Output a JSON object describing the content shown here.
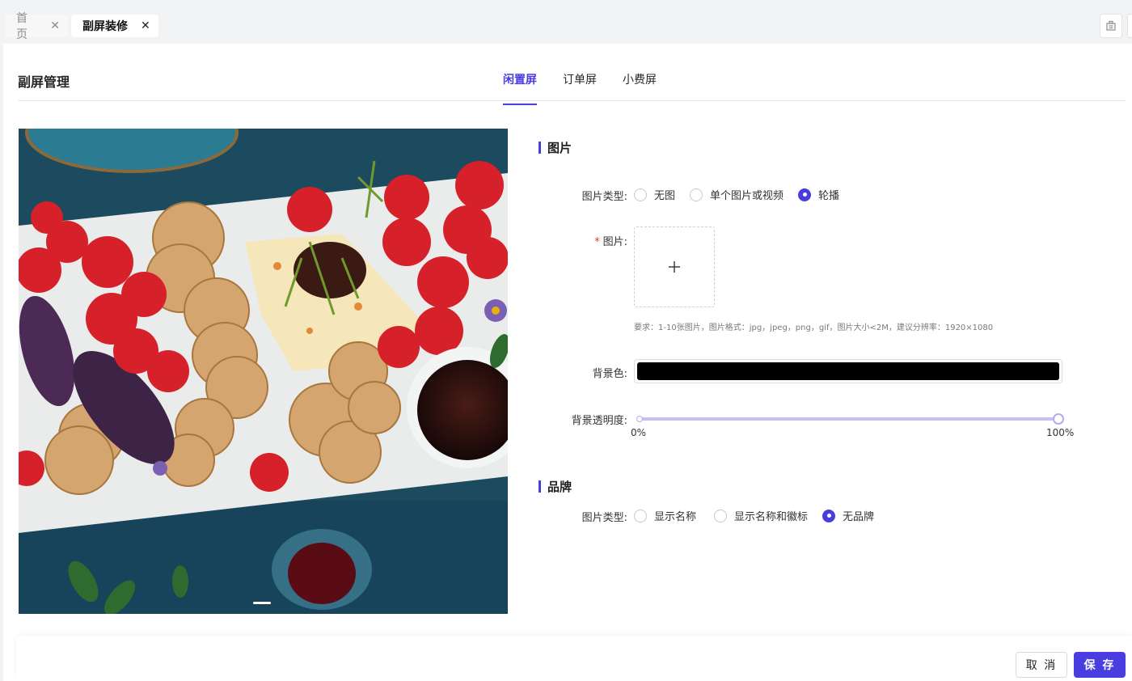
{
  "tabs": [
    {
      "label": "首页",
      "active": false
    },
    {
      "label": "副屏装修",
      "active": true
    }
  ],
  "tab_close_glyph": "✕",
  "page_title": "副屏管理",
  "subtabs": [
    {
      "label": "闲置屏",
      "active": true
    },
    {
      "label": "订单屏",
      "active": false
    },
    {
      "label": "小费屏",
      "active": false
    }
  ],
  "image_section": {
    "title": "图片",
    "type_label": "图片类型:",
    "type_options": [
      {
        "label": "无图",
        "selected": false
      },
      {
        "label": "单个图片或视频",
        "selected": false
      },
      {
        "label": "轮播",
        "selected": true
      }
    ],
    "image_label": "图片:",
    "required_mark": "*",
    "upload_icon": "plus-icon",
    "hint": "要求：1-10张图片，图片格式：jpg，jpeg，png，gif，图片大小<2M，建议分辨率：1920×1080",
    "bg_color_label": "背景色:",
    "bg_color_value": "#000000",
    "opacity_label": "背景透明度:",
    "opacity_value_percent": 100,
    "opacity_min": "0%",
    "opacity_max": "100%"
  },
  "brand_section": {
    "title": "品牌",
    "type_label": "图片类型:",
    "type_options": [
      {
        "label": "显示名称",
        "selected": false
      },
      {
        "label": "显示名称和徽标",
        "selected": false
      },
      {
        "label": "无品牌",
        "selected": true
      }
    ]
  },
  "footer": {
    "cancel_label": "取 消",
    "save_label": "保 存"
  },
  "colors": {
    "accent": "#4a3de0",
    "slider_track": "#c7c0f3"
  }
}
